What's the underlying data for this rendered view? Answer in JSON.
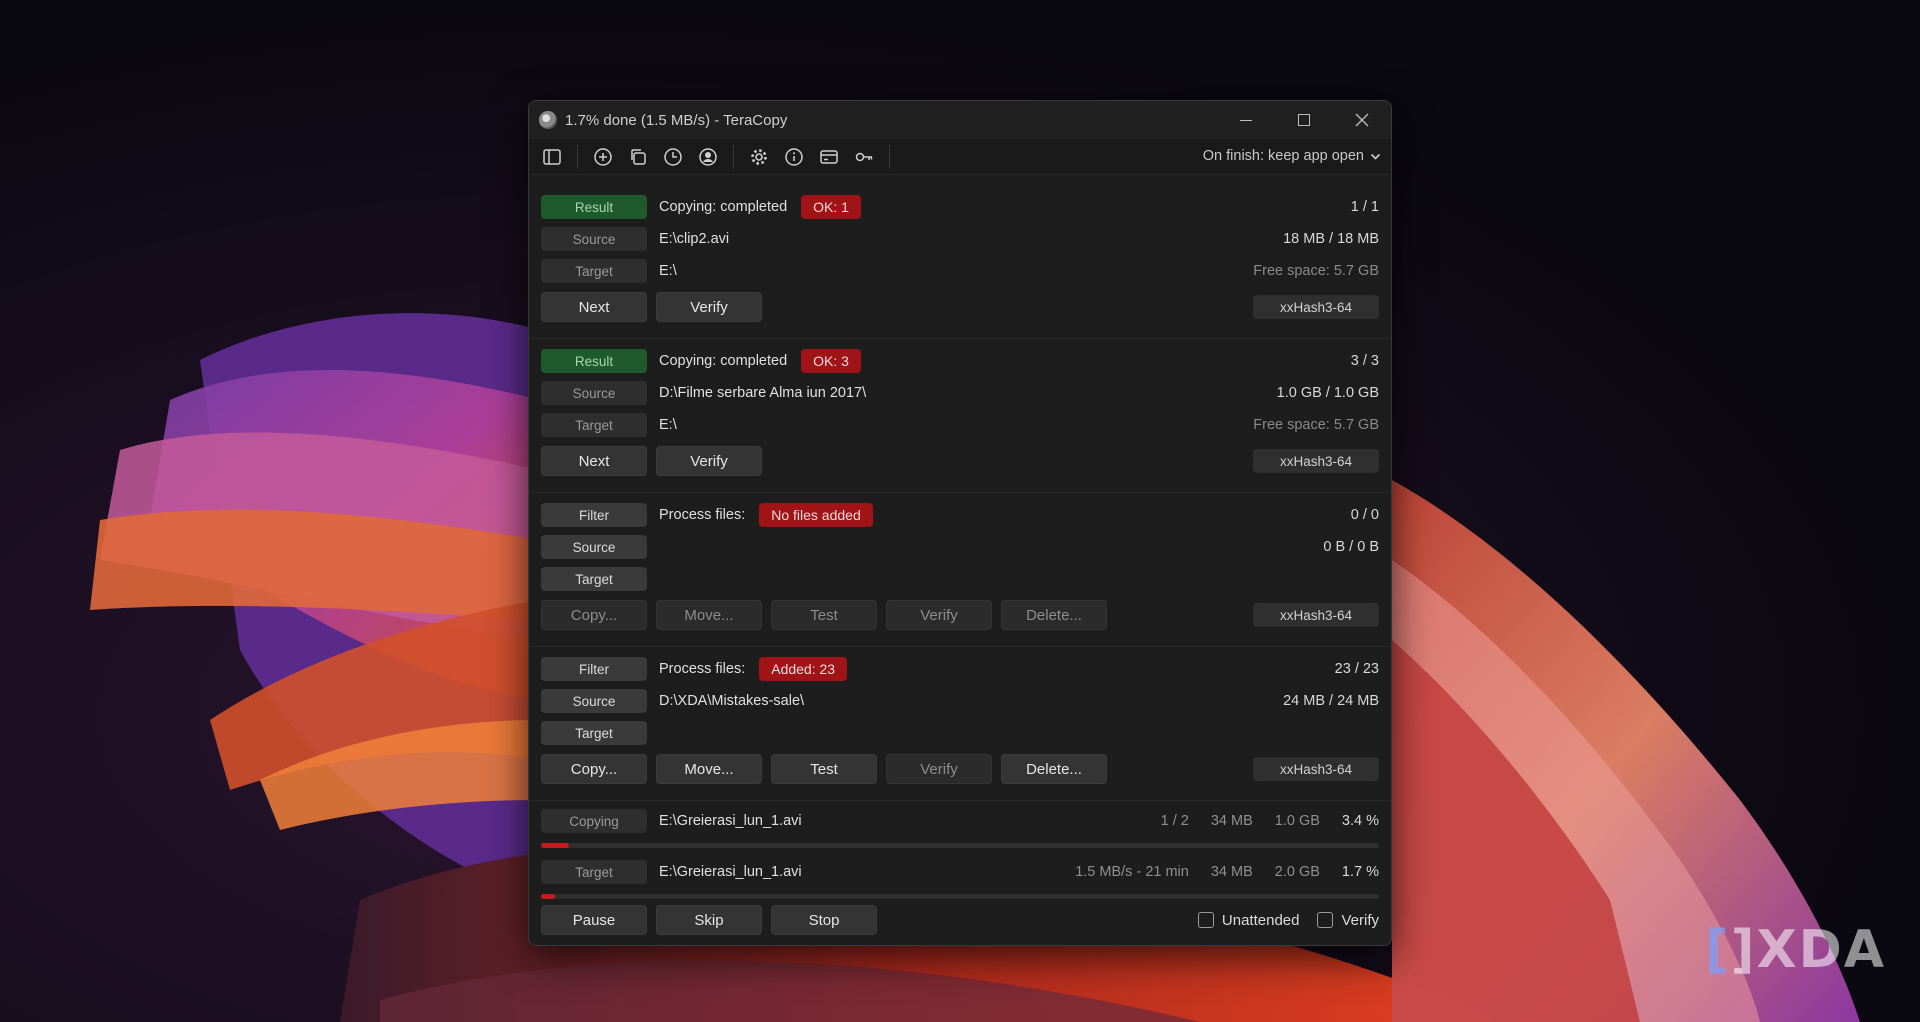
{
  "window": {
    "title": "1.7% done (1.5 MB/s) - TeraCopy"
  },
  "toolbar": {
    "icons": [
      "sidebar-icon",
      "add-icon",
      "copy-icon",
      "history-icon",
      "profile-icon",
      "gear-icon",
      "info-icon",
      "card-icon",
      "key-icon"
    ],
    "on_finish": "On finish: keep app open"
  },
  "panels": [
    {
      "tag": "Result",
      "status": "Copying: completed",
      "badge": "OK: 1",
      "count": "1 / 1",
      "source_tag": "Source",
      "source": "E:\\clip2.avi",
      "size": "18 MB / 18 MB",
      "target_tag": "Target",
      "target": "E:\\",
      "free_space": "Free space: 5.7 GB",
      "buttons": [
        "Next",
        "Verify"
      ],
      "hash": "xxHash3-64"
    },
    {
      "tag": "Result",
      "status": "Copying: completed",
      "badge": "OK: 3",
      "count": "3 / 3",
      "source_tag": "Source",
      "source": "D:\\Filme serbare Alma iun 2017\\",
      "size": "1.0 GB / 1.0 GB",
      "target_tag": "Target",
      "target": "E:\\",
      "free_space": "Free space: 5.7 GB",
      "buttons": [
        "Next",
        "Verify"
      ],
      "hash": "xxHash3-64"
    },
    {
      "tag": "Filter",
      "status": "Process files:",
      "badge": "No files added",
      "count": "0 / 0",
      "source_tag": "Source",
      "source": "",
      "size": "0 B / 0 B",
      "target_tag": "Target",
      "buttons": [
        "Copy...",
        "Move...",
        "Test",
        "Verify",
        "Delete..."
      ],
      "hash": "xxHash3-64"
    },
    {
      "tag": "Filter",
      "status": "Process files:",
      "badge": "Added: 23",
      "count": "23 / 23",
      "source_tag": "Source",
      "source": "D:\\XDA\\Mistakes-sale\\",
      "size": "24 MB / 24 MB",
      "target_tag": "Target",
      "buttons": [
        "Copy...",
        "Move...",
        "Test",
        "Verify",
        "Delete..."
      ],
      "hash": "xxHash3-64"
    }
  ],
  "progress": {
    "copying": {
      "tag": "Copying",
      "file": "E:\\Greierasi_lun_1.avi",
      "files": "1 / 2",
      "done": "34 MB",
      "total": "1.0 GB",
      "percent": "3.4 %",
      "fraction": 0.034
    },
    "target": {
      "tag": "Target",
      "file": "E:\\Greierasi_lun_1.avi",
      "speed": "1.5 MB/s - 21 min",
      "done": "34 MB",
      "total": "2.0 GB",
      "percent": "1.7 %",
      "fraction": 0.017
    }
  },
  "footer": {
    "pause": "Pause",
    "skip": "Skip",
    "stop": "Stop",
    "unattended": "Unattended",
    "verify": "Verify"
  },
  "watermark": {
    "bracket": "[",
    "text": "]XDA"
  }
}
